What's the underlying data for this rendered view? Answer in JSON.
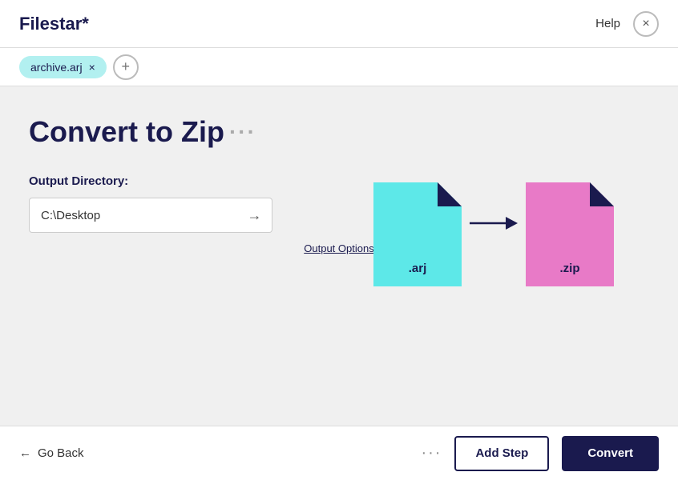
{
  "app": {
    "title": "Filestar*"
  },
  "header": {
    "help_label": "Help",
    "close_icon": "×"
  },
  "tab": {
    "label": "archive.arj",
    "close": "×"
  },
  "add_tab": {
    "icon": "+"
  },
  "main": {
    "page_title": "Convert to Zip",
    "dots": "···",
    "form": {
      "output_dir_label": "Output Directory:",
      "output_dir_value": "C:\\Desktop",
      "output_dir_placeholder": "C:\\Desktop",
      "dir_arrow": "→",
      "output_options_label": "Output Options"
    },
    "illustration": {
      "from_ext": ".arj",
      "to_ext": ".zip",
      "arrow": "→",
      "from_color": "#5de8e8",
      "to_color": "#e87ac7",
      "corner_color": "#1a1a4e"
    }
  },
  "footer": {
    "go_back_icon": "←",
    "go_back_label": "Go Back",
    "more_icon": "···",
    "add_step_label": "Add Step",
    "convert_label": "Convert"
  }
}
